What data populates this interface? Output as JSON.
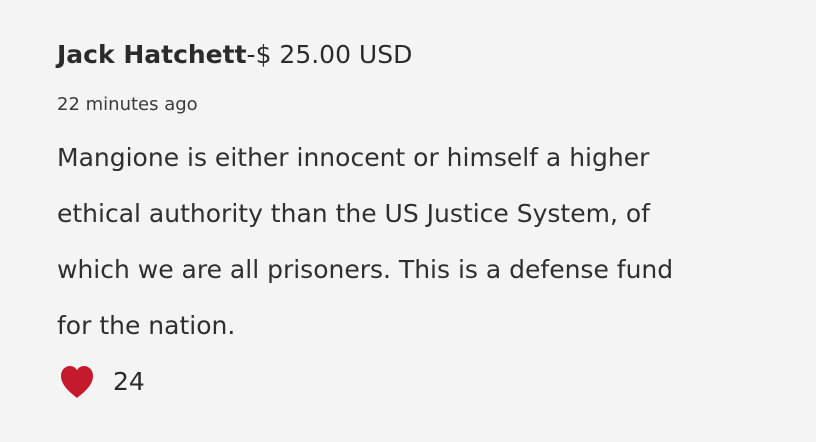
{
  "comment": {
    "author": "Jack Hatchett",
    "amount": "-$ 25.00 USD",
    "time": "22 minutes ago",
    "body_lines": [
      "Mangione is either innocent or himself a higher",
      "ethical authority than the US Justice System, of",
      "which we are all prisoners. This is a defense fund",
      "for the nation."
    ],
    "like_count": "24",
    "like_icon": "heart-icon",
    "like_color": "#c5192d"
  }
}
